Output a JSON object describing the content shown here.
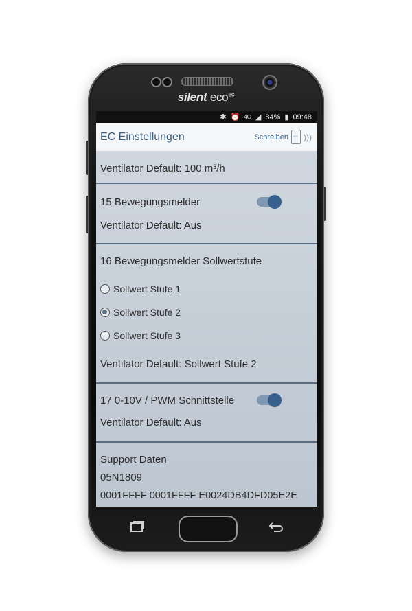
{
  "device": {
    "brand_bold": "silent",
    "brand_light": "eco",
    "brand_sup": "ec"
  },
  "statusbar": {
    "network": "4G",
    "battery": "84%",
    "time": "09:48"
  },
  "appbar": {
    "title": "EC Einstellungen",
    "write_label": "Schreiben",
    "nfc_text": "NFC"
  },
  "settings": {
    "ventilator_default": "Ventilator Default: 100 m³/h",
    "s15": {
      "title": "15  Bewegungsmelder",
      "toggle_on": true,
      "default": "Ventilator Default: Aus"
    },
    "s16": {
      "title": "16  Bewegungsmelder Sollwertstufe",
      "options": [
        "Sollwert Stufe 1",
        "Sollwert Stufe 2",
        "Sollwert Stufe 3"
      ],
      "selected": "Sollwert Stufe 2",
      "default": "Ventilator Default: Sollwert Stufe 2"
    },
    "s17": {
      "title": "17  0-10V / PWM Schnittstelle",
      "toggle_on": true,
      "default": "Ventilator Default: Aus"
    },
    "support": {
      "title": "Support Daten",
      "id": "05N1809",
      "code": "0001FFFF 0001FFFF E0024DB4DFD05E2E"
    }
  },
  "colors": {
    "accent": "#37618c",
    "divider": "#5a6e84",
    "title_text": "#3a5f80"
  }
}
